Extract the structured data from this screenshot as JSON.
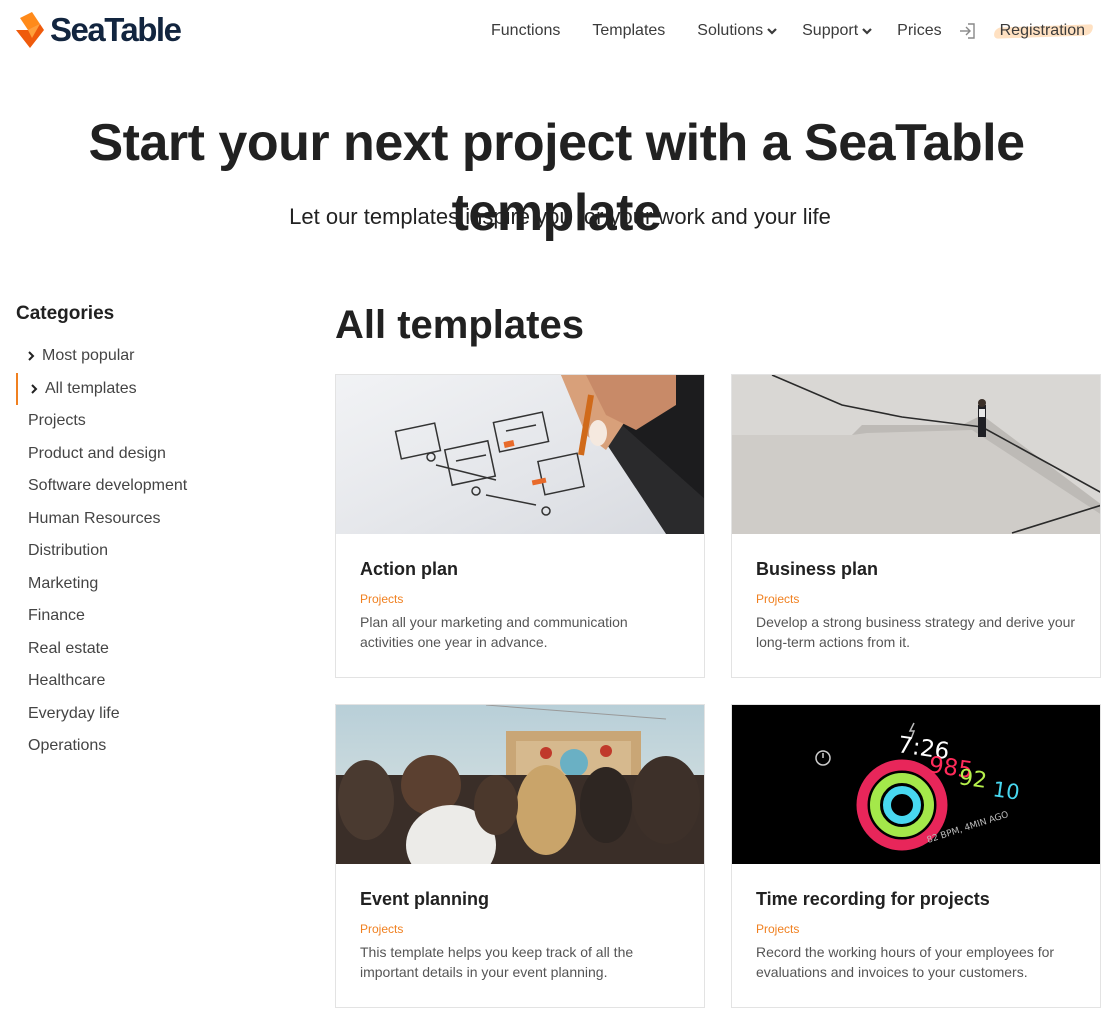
{
  "brand": {
    "name": "SeaTable",
    "accent": "#f08020",
    "dark": "#12253f"
  },
  "nav": {
    "items": [
      {
        "label": "Functions"
      },
      {
        "label": "Templates"
      },
      {
        "label": "Solutions"
      },
      {
        "label": "Support"
      },
      {
        "label": "Prices"
      }
    ],
    "login_icon": "login-icon",
    "registration": "Registration"
  },
  "hero": {
    "title": "Start your next project with a SeaTable template",
    "subtitle": "Let our templates inspire you for your work and your life"
  },
  "sidebar": {
    "title": "Categories",
    "items": [
      {
        "label": "Most popular"
      },
      {
        "label": "All templates"
      },
      {
        "label": "Projects"
      },
      {
        "label": "Product and design"
      },
      {
        "label": "Software development"
      },
      {
        "label": "Human Resources"
      },
      {
        "label": "Distribution"
      },
      {
        "label": "Marketing"
      },
      {
        "label": "Finance"
      },
      {
        "label": "Real estate"
      },
      {
        "label": "Healthcare"
      },
      {
        "label": "Everyday life"
      },
      {
        "label": "Operations"
      }
    ]
  },
  "main": {
    "title": "All templates",
    "cards": [
      {
        "title": "Action plan",
        "category": "Projects",
        "description": "Plan all your marketing and communication activities one year in advance."
      },
      {
        "title": "Business plan",
        "category": "Projects",
        "description": "Develop a strong business strategy and derive your long-term actions from it."
      },
      {
        "title": "Event planning",
        "category": "Projects",
        "description": "This template helps you keep track of all the important details in your event planning."
      },
      {
        "title": "Time recording for projects",
        "category": "Projects",
        "description": "Record the working hours of your employees for evaluations and invoices to your customers."
      }
    ],
    "watch": {
      "time": "7:26",
      "move": "985",
      "exercise": "92",
      "stand": "10",
      "footer": "82 BPM, 4MIN AGO"
    }
  }
}
